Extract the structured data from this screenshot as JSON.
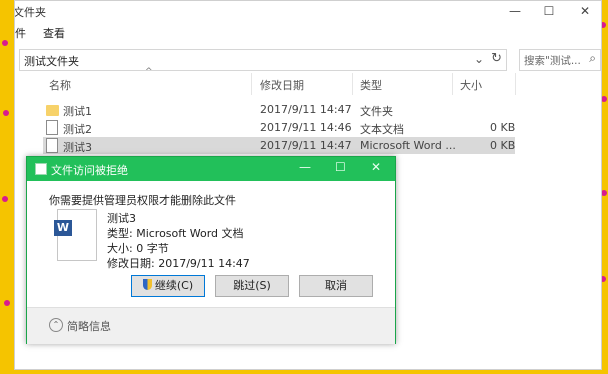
{
  "window": {
    "title": "文件夹",
    "minimize": "—",
    "maximize": "☐",
    "close": "✕"
  },
  "ribbon": {
    "tabs": [
      "件",
      "查看"
    ]
  },
  "address_bar": {
    "path": "测试文件夹",
    "dropdown_glyph": "⌄",
    "refresh_glyph": "↻"
  },
  "search": {
    "placeholder": "搜索\"测试..."
  },
  "columns": {
    "name": "名称",
    "modified": "修改日期",
    "type": "类型",
    "size": "大小"
  },
  "files": [
    {
      "name": "测试1",
      "modified": "2017/9/11 14:47",
      "type": "文件夹",
      "size": "",
      "icon": "folder-icon"
    },
    {
      "name": "测试2",
      "modified": "2017/9/11 14:46",
      "type": "文本文档",
      "size": "0 KB",
      "icon": "text-document-icon"
    },
    {
      "name": "测试3",
      "modified": "2017/9/11 14:47",
      "type": "Microsoft Word ...",
      "size": "0 KB",
      "icon": "word-document-icon",
      "selected": true
    }
  ],
  "dialog": {
    "title": "文件访问被拒绝",
    "minimize": "—",
    "maximize": "☐",
    "close": "✕",
    "message": "你需要提供管理员权限才能删除此文件",
    "file": {
      "name": "测试3",
      "type_line": "类型: Microsoft Word 文档",
      "size_line": "大小: 0 字节",
      "modified_line": "修改日期: 2017/9/11 14:47"
    },
    "buttons": {
      "continue": "继续(C)",
      "skip": "跳过(S)",
      "cancel": "取消"
    },
    "details_toggle": "简略信息"
  },
  "colors": {
    "background": "#f5c400",
    "dialog_title": "#22c05a",
    "selected_row": "#d9d9d9"
  }
}
